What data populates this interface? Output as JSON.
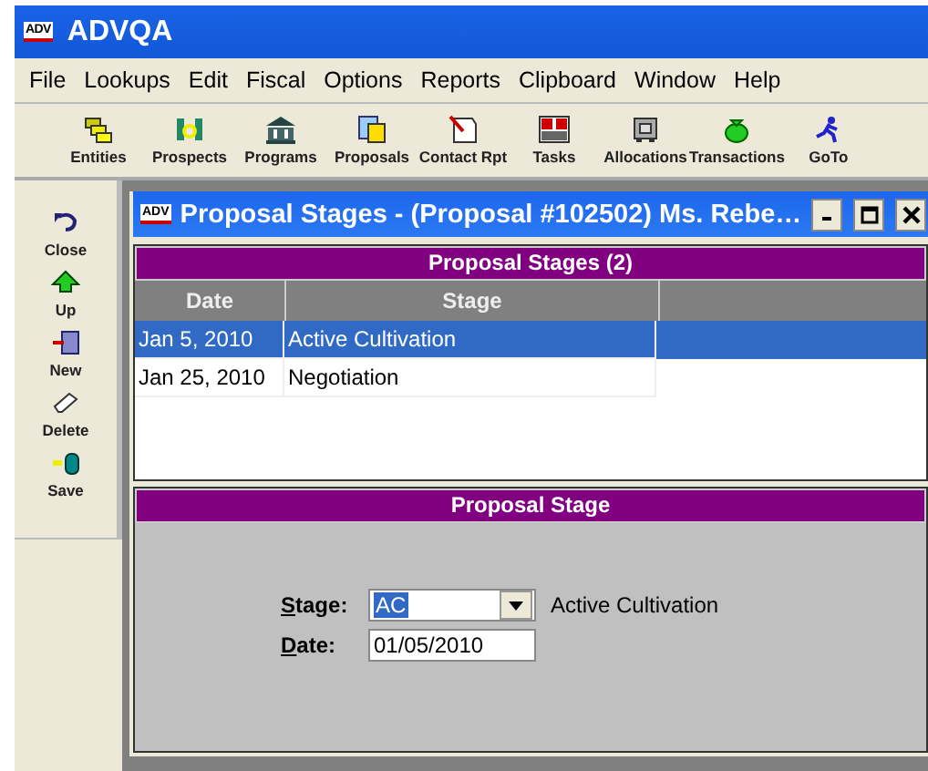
{
  "app": {
    "logo": "ADV",
    "title": "ADVQA"
  },
  "menu": [
    "File",
    "Lookups",
    "Edit",
    "Fiscal",
    "Options",
    "Reports",
    "Clipboard",
    "Window",
    "Help"
  ],
  "toolbar": [
    {
      "kind": "entities",
      "label": "Entities"
    },
    {
      "kind": "prospects",
      "label": "Prospects"
    },
    {
      "kind": "programs",
      "label": "Programs"
    },
    {
      "kind": "proposals",
      "label": "Proposals"
    },
    {
      "kind": "contact",
      "label": "Contact Rpt"
    },
    {
      "kind": "tasks",
      "label": "Tasks"
    },
    {
      "kind": "allocations",
      "label": "Allocations"
    },
    {
      "kind": "transactions",
      "label": "Transactions"
    },
    {
      "kind": "goto",
      "label": "GoTo"
    }
  ],
  "sidebar": [
    {
      "kind": "close",
      "label": "Close"
    },
    {
      "kind": "up",
      "label": "Up"
    },
    {
      "kind": "new",
      "label": "New"
    },
    {
      "kind": "delete",
      "label": "Delete"
    },
    {
      "kind": "save",
      "label": "Save"
    }
  ],
  "window": {
    "logo": "ADV",
    "title": "Proposal Stages - (Proposal #102502) Ms. Rebe…"
  },
  "grid": {
    "title": "Proposal Stages (2)",
    "columns": [
      "Date",
      "Stage"
    ],
    "rows": [
      {
        "cells": [
          "Jan 5, 2010",
          "Active Cultivation"
        ],
        "selected": true
      },
      {
        "cells": [
          "Jan 25, 2010",
          "Negotiation"
        ],
        "selected": false
      }
    ]
  },
  "form": {
    "title": "Proposal Stage",
    "stage": {
      "label": "Stage:",
      "value": "AC",
      "description": "Active Cultivation"
    },
    "date": {
      "label": "Date:",
      "value": "01/05/2010"
    }
  }
}
